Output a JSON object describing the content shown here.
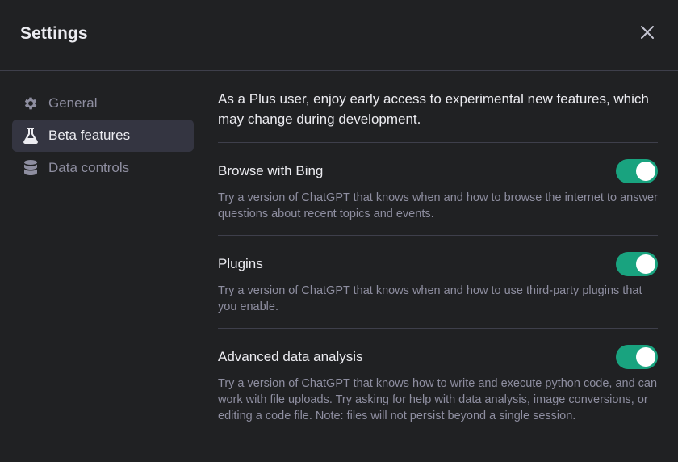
{
  "header": {
    "title": "Settings",
    "close_icon": "close-icon"
  },
  "sidebar": {
    "items": [
      {
        "label": "General",
        "icon": "gear-icon",
        "active": false
      },
      {
        "label": "Beta features",
        "icon": "flask-icon",
        "active": true
      },
      {
        "label": "Data controls",
        "icon": "database-icon",
        "active": false
      }
    ]
  },
  "main": {
    "intro": "As a Plus user, enjoy early access to experimental new features, which may change during development.",
    "features": [
      {
        "title": "Browse with Bing",
        "description": "Try a version of ChatGPT that knows when and how to browse the internet to answer questions about recent topics and events.",
        "enabled": true
      },
      {
        "title": "Plugins",
        "description": "Try a version of ChatGPT that knows when and how to use third-party plugins that you enable.",
        "enabled": true
      },
      {
        "title": "Advanced data analysis",
        "description": "Try a version of ChatGPT that knows how to write and execute python code, and can work with file uploads. Try asking for help with data analysis, image conversions, or editing a code file. Note: files will not persist beyond a single session.",
        "enabled": true
      }
    ]
  },
  "colors": {
    "background": "#202123",
    "active_nav": "#343541",
    "toggle_on": "#19a37f",
    "muted_text": "#8e8ea0",
    "divider": "#3e3f4b"
  }
}
